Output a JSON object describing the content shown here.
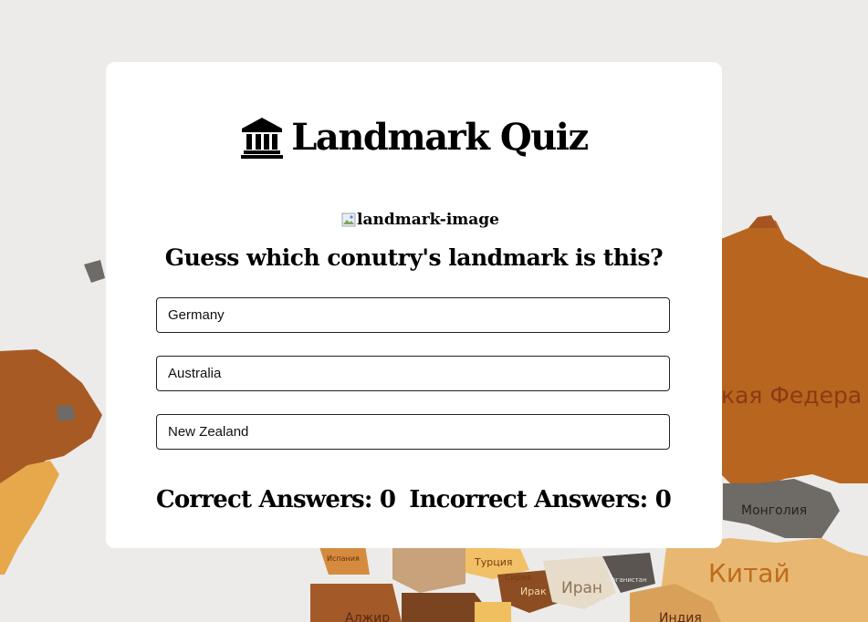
{
  "header": {
    "title": "Landmark Quiz",
    "icon": "landmark-icon"
  },
  "landmark_image": {
    "alt": "landmark-image",
    "icon": "broken-image-icon"
  },
  "question": "Guess which conutry's landmark is this?",
  "options": [
    {
      "label": "Germany"
    },
    {
      "label": "Australia"
    },
    {
      "label": "New Zealand"
    }
  ],
  "score": {
    "correct_label": "Correct Answers: 0",
    "incorrect_label": "Incorrect Answers: 0"
  },
  "background_map": {
    "labels": [
      "кая Федера",
      "Монголия",
      "Китай",
      "Иран",
      "Турция",
      "Ирак",
      "Сирия",
      "Алжир",
      "Индия",
      "Испания",
      "Афганистан"
    ]
  },
  "colors": {
    "card": "#ffffff",
    "page_background": "#ecebea",
    "text": "#000000"
  }
}
